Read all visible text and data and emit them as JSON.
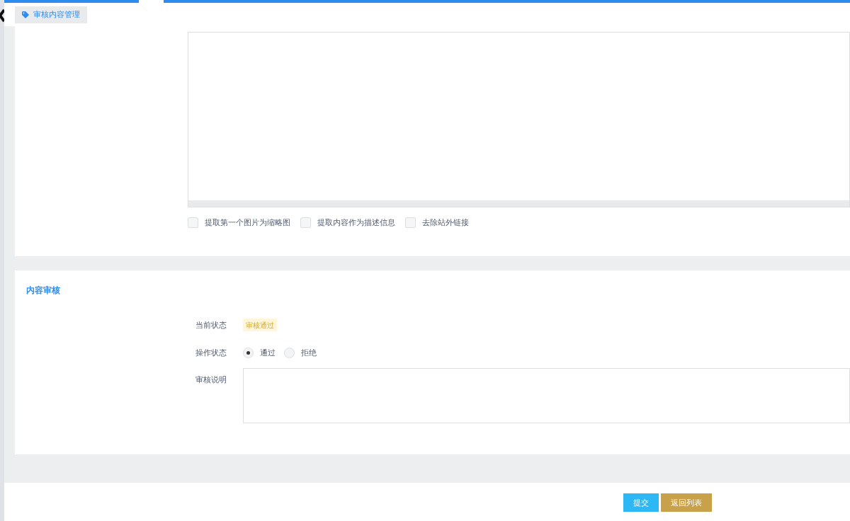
{
  "tab": {
    "label": "审核内容管理"
  },
  "editor_options": [
    {
      "label": "提取第一个图片为缩略图",
      "checked": false
    },
    {
      "label": "提取内容作为描述信息",
      "checked": false
    },
    {
      "label": "去除站外链接",
      "checked": false
    }
  ],
  "review": {
    "title": "内容审核",
    "status_label": "当前状态",
    "status_badge": "审核通过",
    "action_label": "操作状态",
    "options": [
      {
        "label": "通过",
        "selected": true
      },
      {
        "label": "拒绝",
        "selected": false
      }
    ],
    "note_label": "审核说明"
  },
  "buttons": [
    {
      "label": "提交",
      "kind": "primary"
    },
    {
      "label": "返回列表",
      "kind": "secondary"
    }
  ]
}
